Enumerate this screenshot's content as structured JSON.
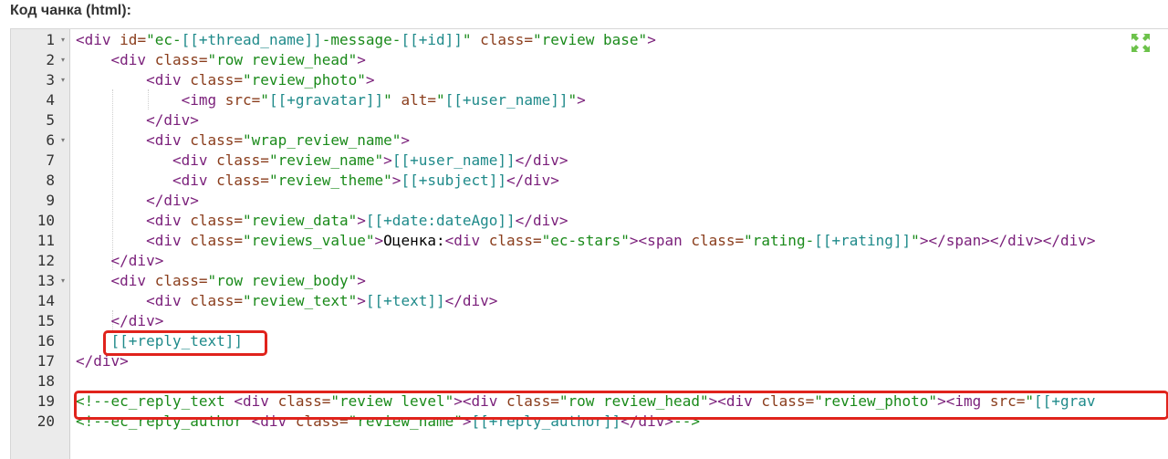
{
  "field": {
    "label": "Код чанка (html):"
  },
  "colors": {
    "tag": "#7a1f7a",
    "attr": "#8a3d1c",
    "string": "#1a8a1a",
    "placeholder": "#1f8a8a",
    "highlight": "#e0231c",
    "gutter_bg": "#ebebeb"
  },
  "icons": {
    "expand": "expand-arrows-icon",
    "fold": "fold-caret-icon"
  },
  "lines": [
    {
      "n": "1",
      "fold": true,
      "tokens": [
        [
          "tag",
          "<div "
        ],
        [
          "attr",
          "id="
        ],
        [
          "str",
          "\"ec-"
        ],
        [
          "ph",
          "[[+thread_name]]"
        ],
        [
          "str",
          "-message-"
        ],
        [
          "ph",
          "[[+id]]"
        ],
        [
          "str",
          "\""
        ],
        [
          "attr",
          " class="
        ],
        [
          "str",
          "\"review base\""
        ],
        [
          "tag",
          ">"
        ]
      ]
    },
    {
      "n": "2",
      "fold": true,
      "tokens": [
        [
          "text",
          "    "
        ],
        [
          "tag",
          "<div "
        ],
        [
          "attr",
          "class="
        ],
        [
          "str",
          "\"row review_head\""
        ],
        [
          "tag",
          ">"
        ]
      ]
    },
    {
      "n": "3",
      "fold": true,
      "tokens": [
        [
          "text",
          "        "
        ],
        [
          "tag",
          "<div "
        ],
        [
          "attr",
          "class="
        ],
        [
          "str",
          "\"review_photo\""
        ],
        [
          "tag",
          ">"
        ]
      ]
    },
    {
      "n": "4",
      "fold": false,
      "tokens": [
        [
          "text",
          "            "
        ],
        [
          "tag",
          "<img "
        ],
        [
          "attr",
          "src="
        ],
        [
          "str",
          "\""
        ],
        [
          "ph",
          "[[+gravatar]]"
        ],
        [
          "str",
          "\""
        ],
        [
          "attr",
          " alt="
        ],
        [
          "str",
          "\""
        ],
        [
          "ph",
          "[[+user_name]]"
        ],
        [
          "str",
          "\""
        ],
        [
          "tag",
          ">"
        ]
      ]
    },
    {
      "n": "5",
      "fold": false,
      "tokens": [
        [
          "text",
          "        "
        ],
        [
          "tag",
          "</div>"
        ]
      ]
    },
    {
      "n": "6",
      "fold": true,
      "tokens": [
        [
          "text",
          "        "
        ],
        [
          "tag",
          "<div "
        ],
        [
          "attr",
          "class="
        ],
        [
          "str",
          "\"wrap_review_name\""
        ],
        [
          "tag",
          ">"
        ]
      ]
    },
    {
      "n": "7",
      "fold": false,
      "tokens": [
        [
          "text",
          "           "
        ],
        [
          "tag",
          "<div "
        ],
        [
          "attr",
          "class="
        ],
        [
          "str",
          "\"review_name\""
        ],
        [
          "tag",
          ">"
        ],
        [
          "ph",
          "[[+user_name]]"
        ],
        [
          "tag",
          "</div>"
        ]
      ]
    },
    {
      "n": "8",
      "fold": false,
      "tokens": [
        [
          "text",
          "           "
        ],
        [
          "tag",
          "<div "
        ],
        [
          "attr",
          "class="
        ],
        [
          "str",
          "\"review_theme\""
        ],
        [
          "tag",
          ">"
        ],
        [
          "ph",
          "[[+subject]]"
        ],
        [
          "tag",
          "</div>"
        ]
      ]
    },
    {
      "n": "9",
      "fold": false,
      "tokens": [
        [
          "text",
          "        "
        ],
        [
          "tag",
          "</div>"
        ]
      ]
    },
    {
      "n": "10",
      "fold": false,
      "tokens": [
        [
          "text",
          "        "
        ],
        [
          "tag",
          "<div "
        ],
        [
          "attr",
          "class="
        ],
        [
          "str",
          "\"review_data\""
        ],
        [
          "tag",
          ">"
        ],
        [
          "ph",
          "[[+date:dateAgo]]"
        ],
        [
          "tag",
          "</div>"
        ]
      ]
    },
    {
      "n": "11",
      "fold": false,
      "tokens": [
        [
          "text",
          "        "
        ],
        [
          "tag",
          "<div "
        ],
        [
          "attr",
          "class="
        ],
        [
          "str",
          "\"reviews_value\""
        ],
        [
          "tag",
          ">"
        ],
        [
          "text",
          "Оценка:"
        ],
        [
          "tag",
          "<div "
        ],
        [
          "attr",
          "class="
        ],
        [
          "str",
          "\"ec-stars\""
        ],
        [
          "tag",
          ">"
        ],
        [
          "tag",
          "<span "
        ],
        [
          "attr",
          "class="
        ],
        [
          "str",
          "\"rating-"
        ],
        [
          "ph",
          "[[+rating]]"
        ],
        [
          "str",
          "\""
        ],
        [
          "tag",
          ">"
        ],
        [
          "tag",
          "</span>"
        ],
        [
          "tag",
          "</div>"
        ],
        [
          "tag",
          "</div>"
        ]
      ]
    },
    {
      "n": "12",
      "fold": false,
      "tokens": [
        [
          "text",
          "    "
        ],
        [
          "tag",
          "</div>"
        ]
      ]
    },
    {
      "n": "13",
      "fold": true,
      "tokens": [
        [
          "text",
          "    "
        ],
        [
          "tag",
          "<div "
        ],
        [
          "attr",
          "class="
        ],
        [
          "str",
          "\"row review_body\""
        ],
        [
          "tag",
          ">"
        ]
      ]
    },
    {
      "n": "14",
      "fold": false,
      "tokens": [
        [
          "text",
          "        "
        ],
        [
          "tag",
          "<div "
        ],
        [
          "attr",
          "class="
        ],
        [
          "str",
          "\"review_text\""
        ],
        [
          "tag",
          ">"
        ],
        [
          "ph",
          "[[+text]]"
        ],
        [
          "tag",
          "</div>"
        ]
      ]
    },
    {
      "n": "15",
      "fold": false,
      "tokens": [
        [
          "text",
          "    "
        ],
        [
          "tag",
          "</div>"
        ]
      ]
    },
    {
      "n": "16",
      "fold": false,
      "tokens": [
        [
          "text",
          "    "
        ],
        [
          "ph",
          "[[+reply_text]]"
        ]
      ]
    },
    {
      "n": "17",
      "fold": false,
      "tokens": [
        [
          "tag",
          "</div>"
        ]
      ]
    },
    {
      "n": "18",
      "fold": false,
      "tokens": []
    },
    {
      "n": "19",
      "fold": false,
      "tokens": [
        [
          "comment",
          "<!--ec_reply_text "
        ],
        [
          "tag",
          "<div "
        ],
        [
          "attr",
          "class="
        ],
        [
          "str",
          "\"review level\""
        ],
        [
          "tag",
          ">"
        ],
        [
          "tag",
          "<div "
        ],
        [
          "attr",
          "class="
        ],
        [
          "str",
          "\"row review_head\""
        ],
        [
          "tag",
          ">"
        ],
        [
          "tag",
          "<div "
        ],
        [
          "attr",
          "class="
        ],
        [
          "str",
          "\"review_photo\""
        ],
        [
          "tag",
          ">"
        ],
        [
          "tag",
          "<img "
        ],
        [
          "attr",
          "src="
        ],
        [
          "str",
          "\""
        ],
        [
          "ph",
          "[[+grav"
        ]
      ]
    },
    {
      "n": "20",
      "fold": false,
      "tokens": [
        [
          "comment",
          "<!--ec_reply_author "
        ],
        [
          "tag",
          "<div "
        ],
        [
          "attr",
          "class="
        ],
        [
          "str",
          "\"review_name\""
        ],
        [
          "tag",
          ">"
        ],
        [
          "ph",
          "[[+reply_author]]"
        ],
        [
          "tag",
          "</div>"
        ],
        [
          "comment",
          "-->"
        ]
      ]
    }
  ]
}
